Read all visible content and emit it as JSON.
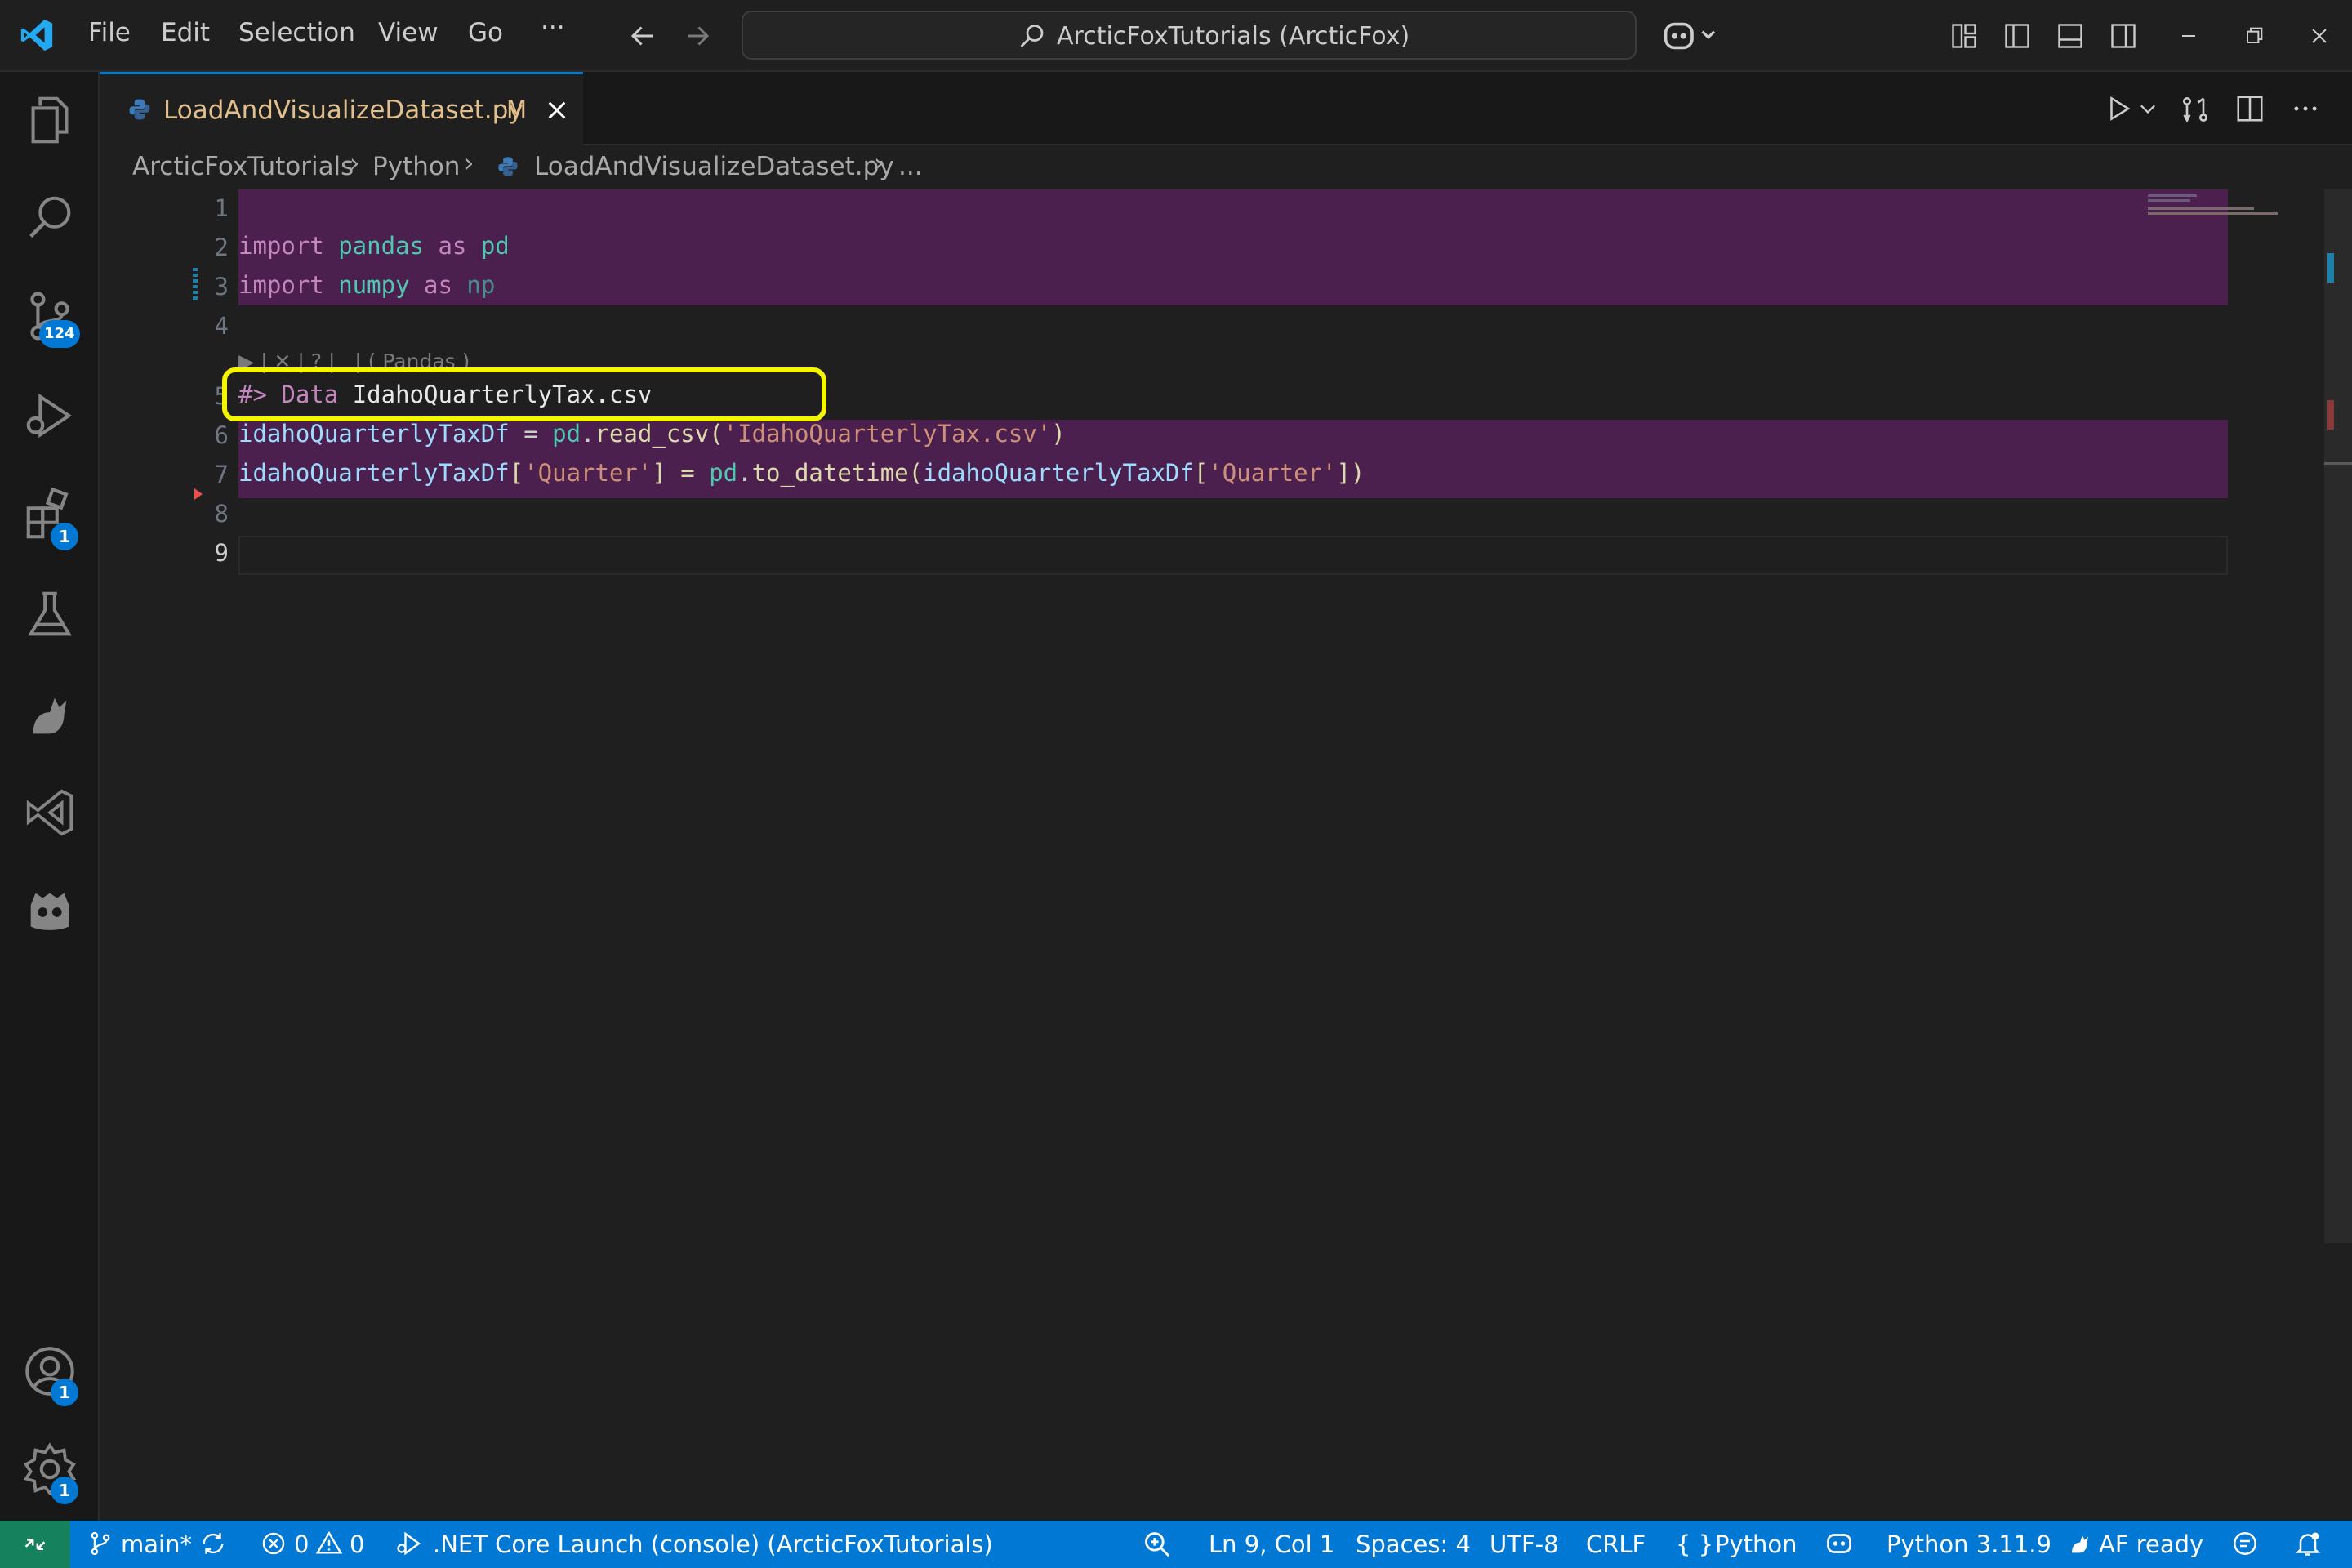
{
  "titlebar": {
    "menu": [
      "File",
      "Edit",
      "Selection",
      "View",
      "Go",
      "···"
    ],
    "search_text": "ArcticFoxTutorials (ArcticFox)"
  },
  "activity": {
    "scm_badge": "124",
    "extensions_badge": "1",
    "accounts_badge": "1",
    "settings_badge": "1"
  },
  "tab": {
    "filename": "LoadAndVisualizeDataset.py",
    "modified": "M"
  },
  "breadcrumb": [
    "ArcticFoxTutorials",
    "Python",
    "LoadAndVisualizeDataset.py",
    "..."
  ],
  "editor": {
    "line_numbers": [
      "1",
      "2",
      "3",
      "4",
      "5",
      "6",
      "7",
      "8",
      "9"
    ],
    "codelens": "▶ | ✕ | ? |   | ( Pandas )",
    "lines": {
      "l2": {
        "a": "import",
        "b": " pandas ",
        "c": "as",
        "d": " pd"
      },
      "l3": {
        "a": "import",
        "b": " numpy ",
        "c": "as",
        "d": " np"
      },
      "l5": {
        "a": "#> Data ",
        "b": "IdahoQuarterlyTax.csv"
      },
      "l6": {
        "a": "idahoQuarterlyTaxDf",
        "b": " = ",
        "c": "pd",
        "d": ".",
        "e": "read_csv",
        "f": "(",
        "g": "'IdahoQuarterlyTax.csv'",
        "h": ")"
      },
      "l7": {
        "a": "idahoQuarterlyTaxDf",
        "b": "[",
        "c": "'Quarter'",
        "d": "] = ",
        "e": "pd",
        "f": ".",
        "g": "to_datetime",
        "h": "(",
        "i": "idahoQuarterlyTaxDf",
        "j": "[",
        "k": "'Quarter'",
        "l": "])"
      }
    }
  },
  "statusbar": {
    "branch": "main*",
    "errors": "0",
    "warnings": "0",
    "launch": ".NET Core Launch (console) (ArcticFoxTutorials)",
    "position": "Ln 9, Col 1",
    "spaces": "Spaces: 4",
    "encoding": "UTF-8",
    "eol": "CRLF",
    "language": "Python",
    "interpreter": "Python 3.11.9",
    "af": "AF ready"
  },
  "colors": {
    "accent": "#0078d4",
    "highlight": "#4b1f4e",
    "annotation": "#f5f500"
  }
}
